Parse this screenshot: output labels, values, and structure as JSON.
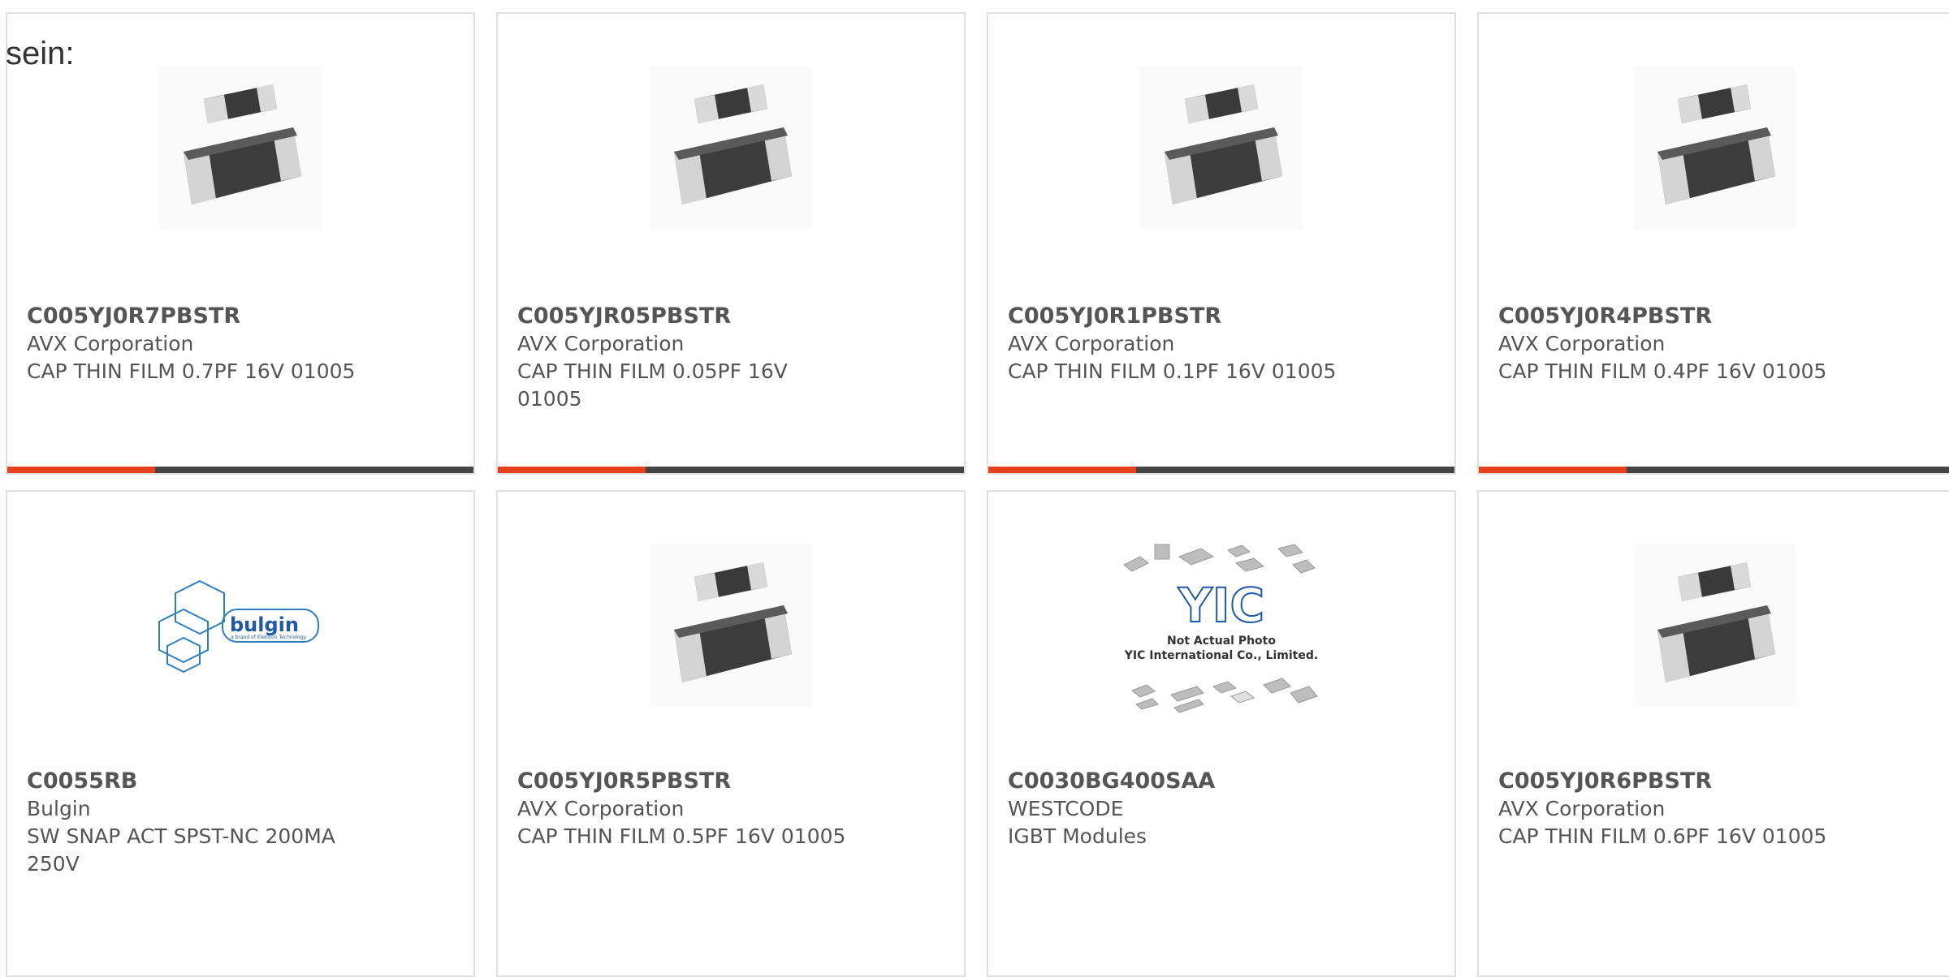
{
  "intro_text": "sein:",
  "colors": {
    "accent_bar": "#e8401c",
    "dark_bar": "#444444",
    "card_border": "#e0e0e0",
    "bulgin_blue": "#2f7fbf",
    "yic_blue": "#1f5aa8"
  },
  "products": [
    {
      "part_number": "C005YJ0R7PBSTR",
      "manufacturer": "AVX Corporation",
      "description": "CAP THIN FILM 0.7PF 16V 01005",
      "image_icon": "smd-capacitor-image"
    },
    {
      "part_number": "C005YJR05PBSTR",
      "manufacturer": "AVX Corporation",
      "description": "CAP THIN FILM 0.05PF 16V 01005",
      "image_icon": "smd-capacitor-image"
    },
    {
      "part_number": "C005YJ0R1PBSTR",
      "manufacturer": "AVX Corporation",
      "description": "CAP THIN FILM 0.1PF 16V 01005",
      "image_icon": "smd-capacitor-image"
    },
    {
      "part_number": "C005YJ0R4PBSTR",
      "manufacturer": "AVX Corporation",
      "description": "CAP THIN FILM 0.4PF 16V 01005",
      "image_icon": "smd-capacitor-image"
    },
    {
      "part_number": "C0055RB",
      "manufacturer": "Bulgin",
      "description": "SW SNAP ACT SPST-NC 200MA 250V",
      "image_icon": "bulgin-logo",
      "logo_text": "bulgin",
      "logo_subtext": "a brand of Elektron Technology"
    },
    {
      "part_number": "C005YJ0R5PBSTR",
      "manufacturer": "AVX Corporation",
      "description": "CAP THIN FILM 0.5PF 16V 01005",
      "image_icon": "smd-capacitor-image"
    },
    {
      "part_number": "C0030BG400SAA",
      "manufacturer": "WESTCODE",
      "description": "IGBT Modules",
      "image_icon": "yic-placeholder-image",
      "logo_text": "YIC",
      "placeholder_line1": "Not Actual Photo",
      "placeholder_line2": "YIC International Co., Limited."
    },
    {
      "part_number": "C005YJ0R6PBSTR",
      "manufacturer": "AVX Corporation",
      "description": "CAP THIN FILM 0.6PF 16V 01005",
      "image_icon": "smd-capacitor-image"
    }
  ]
}
